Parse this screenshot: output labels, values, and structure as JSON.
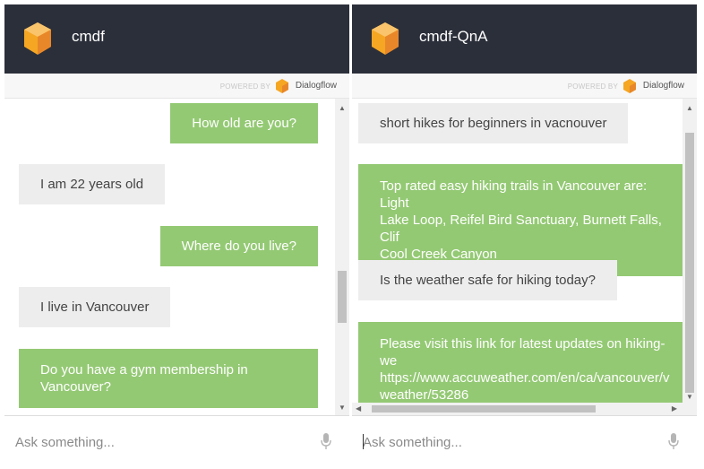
{
  "left_panel": {
    "title": "cmdf",
    "powered_by": "POWERED BY",
    "brand": "Dialogflow",
    "messages": [
      {
        "role": "user",
        "text": "How old are you?"
      },
      {
        "role": "bot",
        "text": "I am 22 years old"
      },
      {
        "role": "user",
        "text": "Where do you live?"
      },
      {
        "role": "bot",
        "text": "I live in Vancouver"
      },
      {
        "role": "user",
        "text": "Do you have a gym membership in\nVancouver?"
      }
    ],
    "input_placeholder": "Ask something..."
  },
  "right_panel": {
    "title": "cmdf-QnA",
    "powered_by": "POWERED BY",
    "brand": "Dialogflow",
    "messages": [
      {
        "role": "user",
        "text": "short hikes for beginners in vacnouver"
      },
      {
        "role": "bot",
        "text": "Top rated easy hiking trails in Vancouver are: Light\nLake Loop, Reifel Bird Sanctuary, Burnett Falls, Clif\nCool Creek Canyon"
      },
      {
        "role": "user",
        "text": "Is the weather safe for hiking today?"
      },
      {
        "role": "bot",
        "text": "Please visit this link for latest updates on hiking-we\nhttps://www.accuweather.com/en/ca/vancouver/v\nweather/53286"
      }
    ],
    "input_placeholder": "Ask something..."
  },
  "colors": {
    "header_bg": "#2b2f3a",
    "green_bubble": "#94c974",
    "grey_bubble": "#ededed",
    "logo_orange": "#f5a623"
  },
  "icons": {
    "logo": "dialogflow-logo-icon",
    "mic": "microphone-icon"
  }
}
